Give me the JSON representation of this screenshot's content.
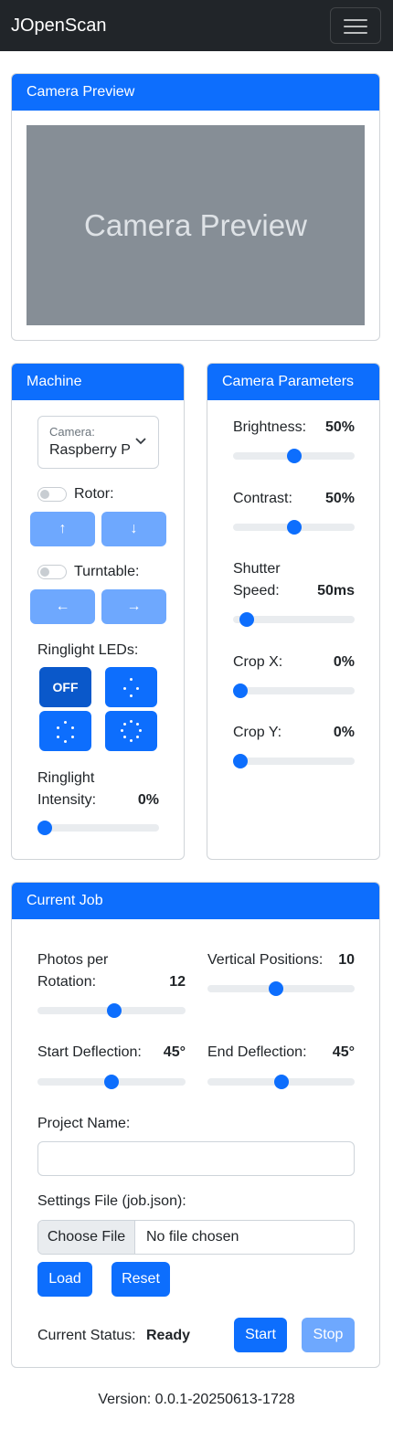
{
  "navbar": {
    "brand": "JOpenScan"
  },
  "preview": {
    "header": "Camera Preview",
    "placeholder": "Camera Preview"
  },
  "machine": {
    "header": "Machine",
    "camera": {
      "label": "Camera:",
      "value": "Raspberry P"
    },
    "rotor": {
      "label": "Rotor:",
      "up": "↑",
      "down": "↓"
    },
    "turntable": {
      "label": "Turntable:",
      "left": "←",
      "right": "→"
    },
    "ringlight": {
      "label": "Ringlight LEDs:",
      "off": "OFF"
    },
    "intensity": {
      "label1": "Ringlight",
      "label2": "Intensity:",
      "value": "0%",
      "level": 0
    }
  },
  "camera_params": {
    "header": "Camera Parameters",
    "brightness": {
      "label": "Brightness:",
      "value": "50%",
      "level": 50
    },
    "contrast": {
      "label": "Contrast:",
      "value": "50%",
      "level": 50
    },
    "shutter": {
      "label1": "Shutter",
      "label2": "Speed:",
      "value": "50ms",
      "level": 6
    },
    "crop_x": {
      "label": "Crop X:",
      "value": "0%",
      "level": 0
    },
    "crop_y": {
      "label": "Crop Y:",
      "value": "0%",
      "level": 0
    }
  },
  "job": {
    "header": "Current Job",
    "photos": {
      "label1": "Photos per",
      "label2": "Rotation:",
      "value": "12",
      "level": 52
    },
    "vertical": {
      "label": "Vertical Positions:",
      "value": "10",
      "level": 46
    },
    "start_deflection": {
      "label": "Start Deflection:",
      "value": "45°",
      "level": 50
    },
    "end_deflection": {
      "label": "End Deflection:",
      "value": "45°",
      "level": 50
    },
    "project_name": {
      "label": "Project Name:",
      "value": ""
    },
    "settings_file": {
      "label": "Settings File (job.json):",
      "button": "Choose File",
      "status": "No file chosen"
    },
    "load": "Load",
    "reset": "Reset",
    "status_label": "Current Status:",
    "status_value": "Ready",
    "start": "Start",
    "stop": "Stop"
  },
  "footer": {
    "version": "Version: 0.0.1-20250613-1728"
  },
  "colors": {
    "primary": "#0d6efd",
    "primary_light": "#6ea8fe",
    "navbar": "#212529",
    "preview": "#868e96"
  }
}
